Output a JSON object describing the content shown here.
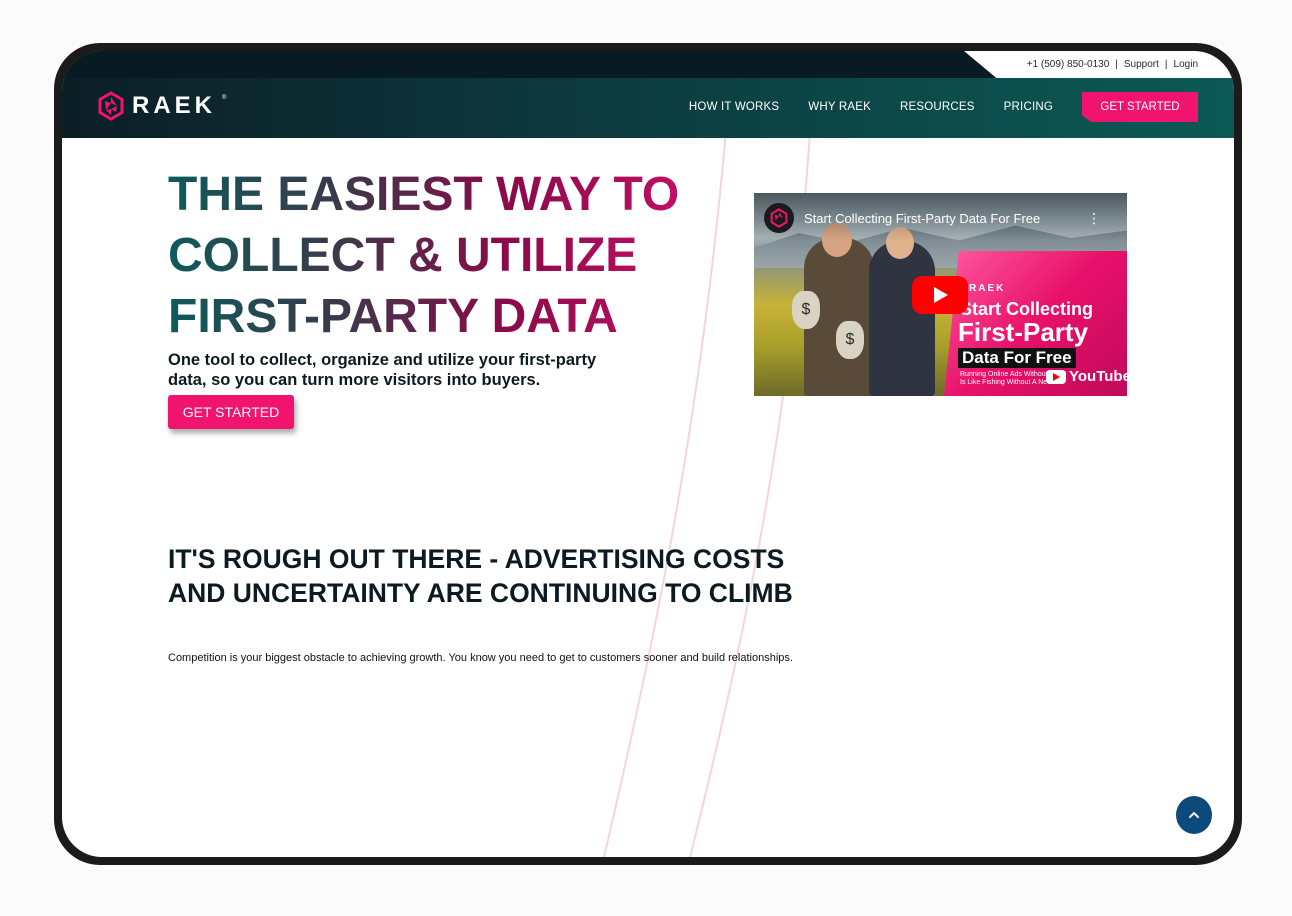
{
  "header": {
    "phone": "+1 (509) 850-0130",
    "support": "Support",
    "login": "Login",
    "logo_text": "RAEK",
    "logo_reg": "®",
    "nav": [
      "HOW IT WORKS",
      "WHY RAEK",
      "RESOURCES",
      "PRICING"
    ],
    "cta": "GET STARTED"
  },
  "hero": {
    "title_lines": [
      "THE EASIEST WAY TO",
      "COLLECT & UTILIZE",
      "FIRST-PARTY DATA"
    ],
    "subtitle": "One tool to collect, organize and utilize your first-party data, so you can turn more visitors into buyers.",
    "cta": "GET STARTED"
  },
  "video": {
    "title": "Start Collecting First-Party Data For Free",
    "brand": "RAEK",
    "line1": "Start Collecting",
    "line2": "First-Party",
    "line3": "Data For Free",
    "small_text": "Running Online Ads Without A Net Is Like Fishing Without A Net",
    "youtube": "YouTube",
    "bag_symbol": "$"
  },
  "section": {
    "title": "IT'S ROUGH OUT THERE - ADVERTISING COSTS AND UNCERTAINTY ARE CONTINUING TO CLIMB",
    "body": "Competition is your biggest obstacle to achieving growth. You know you need to get to customers sooner and build relationships."
  },
  "colors": {
    "brand_pink": "#f0146e",
    "header_dark": "#0b1e26",
    "header_teal": "#0b5a55",
    "scroll_button": "#0b4a7a"
  }
}
